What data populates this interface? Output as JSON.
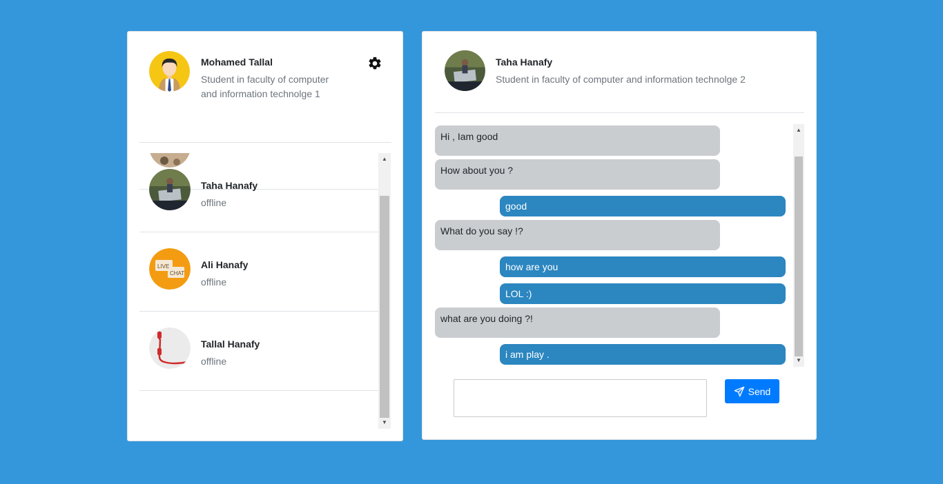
{
  "me": {
    "name": "Mohamed Tallal",
    "description": "Student in faculty of computer and information technolge 1",
    "settings_icon": "gear-icon"
  },
  "contacts": [
    {
      "name": "Taha Hanafy",
      "status": "offline"
    },
    {
      "name": "Ali Hanafy",
      "status": "offline",
      "avatar_text_1": "LIVE",
      "avatar_text_2": "CHAT"
    },
    {
      "name": "Tallal Hanafy",
      "status": "offline"
    }
  ],
  "chat": {
    "peer_name": "Taha Hanafy",
    "peer_description": "Student in faculty of computer and information technolge 2",
    "messages": [
      {
        "direction": "in",
        "text": "Hi , Iam good"
      },
      {
        "direction": "in",
        "text": "How about you ?"
      },
      {
        "direction": "out",
        "text": "good"
      },
      {
        "direction": "in",
        "text": "What do you say !?"
      },
      {
        "direction": "out",
        "text": "how are you"
      },
      {
        "direction": "out",
        "text": "LOL :)"
      },
      {
        "direction": "in",
        "text": "what are you doing ?!"
      },
      {
        "direction": "out",
        "text": "i am play ."
      }
    ],
    "input_value": "",
    "send_label": "Send",
    "send_icon": "paper-plane-icon"
  },
  "colors": {
    "background": "#3597db",
    "incoming_bubble": "#cacdd0",
    "outgoing_bubble": "#2c86c0",
    "send_button": "#007bff"
  }
}
